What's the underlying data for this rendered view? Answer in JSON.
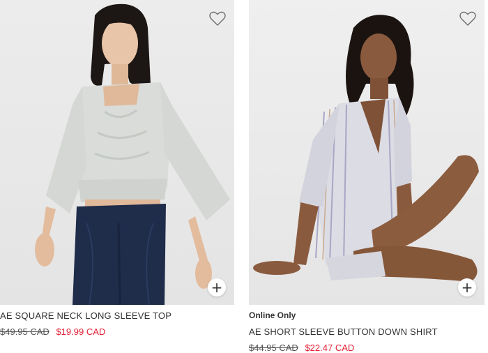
{
  "products": [
    {
      "badge": "",
      "name": "AE SQUARE NECK LONG SLEEVE TOP",
      "price_original": "$49.95 CAD",
      "price_sale": "$19.99 CAD",
      "favorite_icon": "heart-outline-icon",
      "quick_add_icon": "plus-icon",
      "quick_add_symbol": "+"
    },
    {
      "badge": "Online Only",
      "name": "AE SHORT SLEEVE BUTTON DOWN SHIRT",
      "price_original": "$44.95 CAD",
      "price_sale": "$22.47 CAD",
      "favorite_icon": "heart-outline-icon",
      "quick_add_icon": "plus-icon",
      "quick_add_symbol": "+"
    }
  ],
  "colors": {
    "sale_price": "#e31e35",
    "text": "#333333",
    "image_background": "#e8e8e8"
  }
}
